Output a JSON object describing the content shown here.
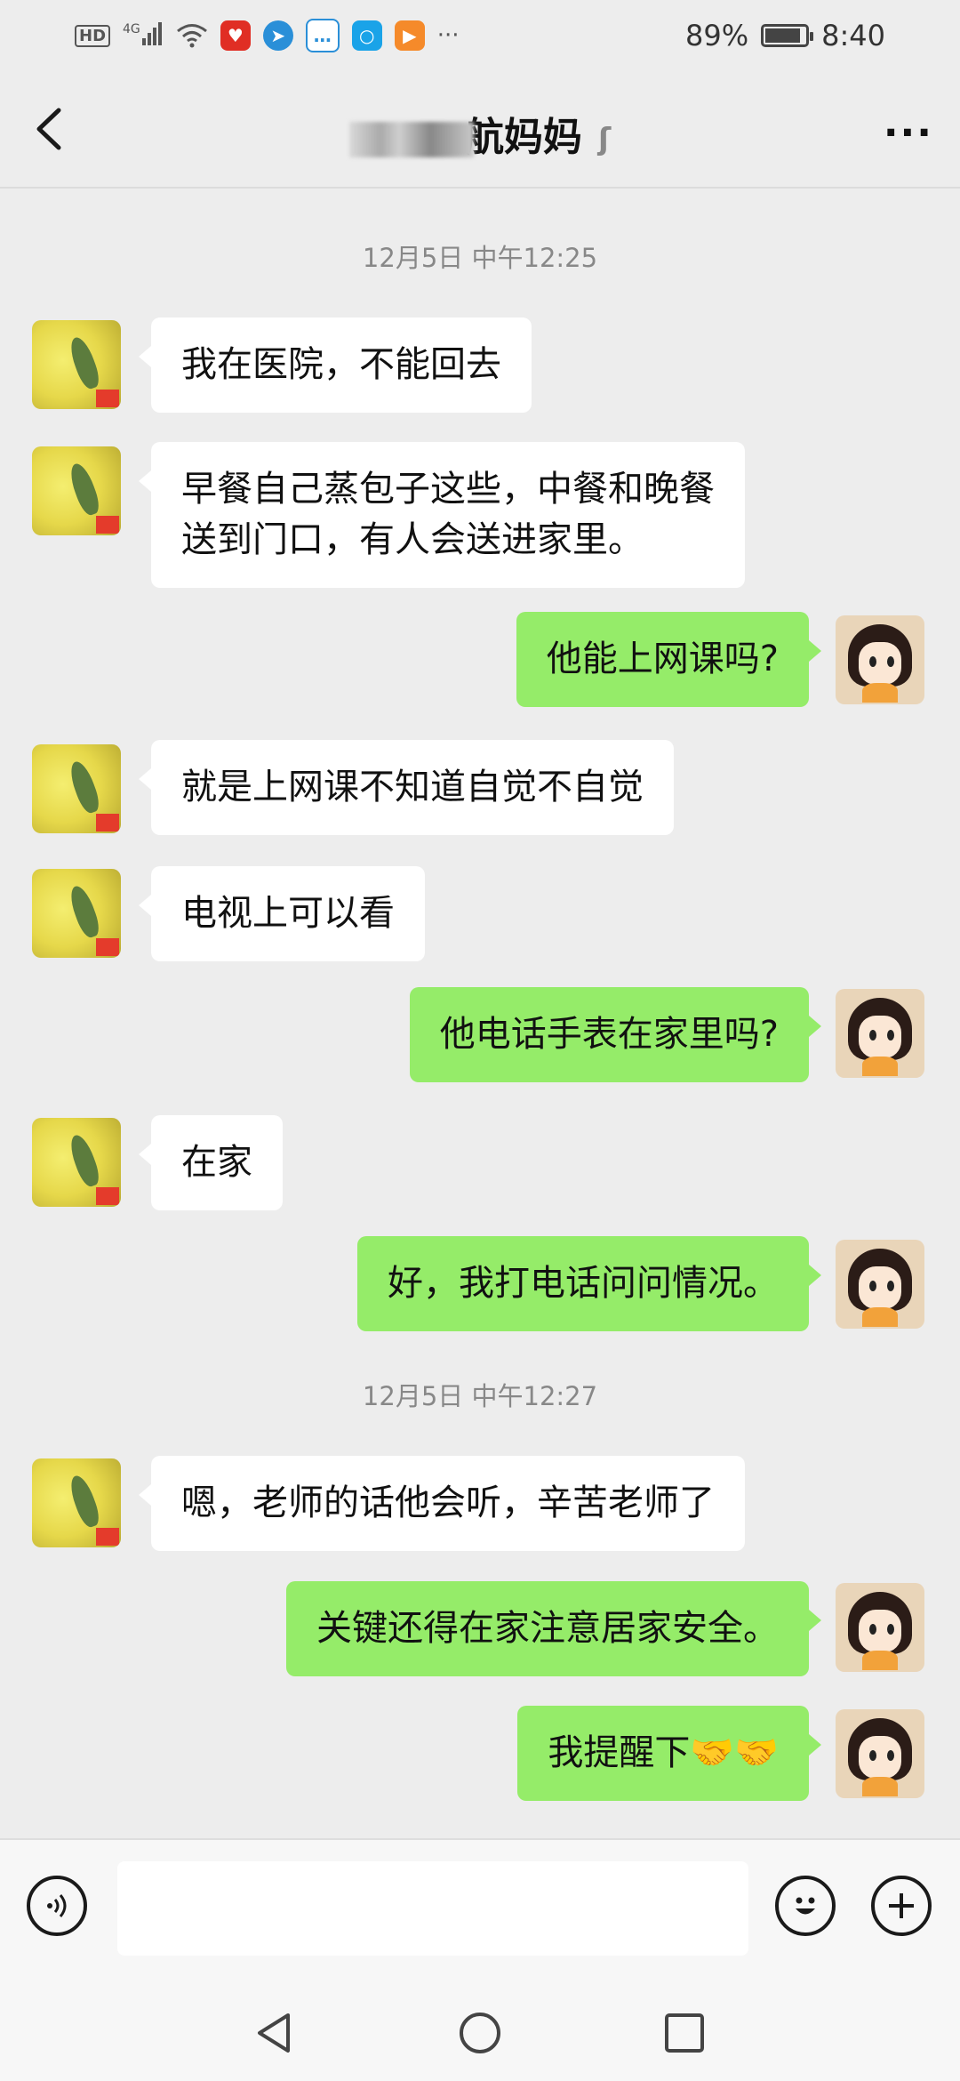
{
  "status_bar": {
    "hd": "HD",
    "network": "4G",
    "battery_percent": "89%",
    "battery_level": 0.89,
    "time": "8:40",
    "app_icons": [
      "pinduoduo-icon",
      "telegram-icon",
      "chat-icon",
      "search-app-icon",
      "video-app-icon"
    ]
  },
  "header": {
    "title": "航妈妈",
    "title_visible": "航妈妈",
    "back_icon": "chevron-left-icon",
    "ear_icon": "ear-icon",
    "more_icon": "more-icon"
  },
  "messages": [
    {
      "type": "timestamp",
      "text": "12月5日 中午12:25"
    },
    {
      "side": "left",
      "text": "我在医院，不能回去"
    },
    {
      "side": "left",
      "text": "早餐自己蒸包子这些，中餐和晚餐\n送到门口，有人会送进家里。"
    },
    {
      "side": "right",
      "text": "他能上网课吗?"
    },
    {
      "side": "left",
      "text": "就是上网课不知道自觉不自觉"
    },
    {
      "side": "left",
      "text": "电视上可以看"
    },
    {
      "side": "right",
      "text": "他电话手表在家里吗?"
    },
    {
      "side": "left",
      "text": "在家"
    },
    {
      "side": "right",
      "text": "好，我打电话问问情况。"
    },
    {
      "type": "timestamp",
      "text": "12月5日 中午12:27"
    },
    {
      "side": "left",
      "text": "嗯，老师的话他会听，辛苦老师了"
    },
    {
      "side": "right",
      "text": "关键还得在家注意居家安全。"
    },
    {
      "side": "right",
      "text": "我提醒下🤝🤝"
    }
  ],
  "input_bar": {
    "voice_icon": "voice-icon",
    "emoji_icon": "emoji-icon",
    "add_icon": "plus-icon",
    "input_value": ""
  },
  "nav_bar": {
    "back_icon": "nav-back-icon",
    "home_icon": "nav-home-icon",
    "recents_icon": "nav-recents-icon"
  },
  "colors": {
    "background": "#ededed",
    "bubble_self": "#95ec69",
    "bubble_other": "#ffffff",
    "timestamp": "#888888"
  }
}
